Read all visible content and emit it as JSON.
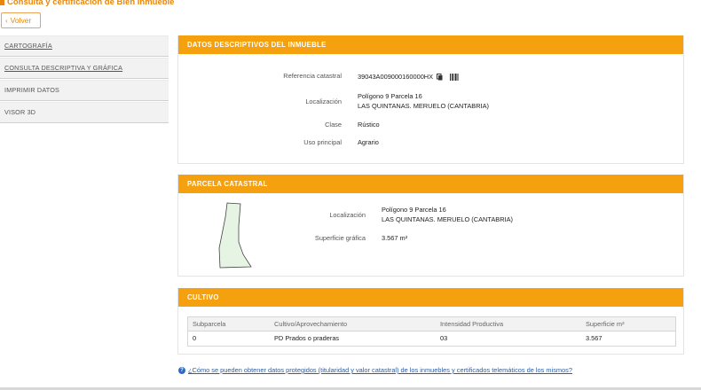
{
  "page": {
    "title": "Consulta y certificación de Bien Inmueble",
    "back_label": "Volver"
  },
  "sidebar": {
    "items": [
      {
        "label": "CARTOGRAFÍA",
        "link": true
      },
      {
        "label": "CONSULTA DESCRIPTIVA Y GRÁFICA",
        "link": true
      },
      {
        "label": "IMPRIMIR DATOS",
        "link": false
      },
      {
        "label": "VISOR 3D",
        "link": false
      }
    ]
  },
  "descriptivos": {
    "title": "DATOS DESCRIPTIVOS DEL INMUEBLE",
    "ref_label": "Referencia catastral",
    "ref_value": "39043A009000160000HX",
    "loc_label": "Localización",
    "loc_line1": "Polígono 9 Parcela 16",
    "loc_line2": "LAS QUINTANAS. MERUELO (CANTABRIA)",
    "clase_label": "Clase",
    "clase_value": "Rústico",
    "uso_label": "Uso principal",
    "uso_value": "Agrario"
  },
  "parcela": {
    "title": "PARCELA CATASTRAL",
    "loc_label": "Localización",
    "loc_line1": "Polígono 9 Parcela 16",
    "loc_line2": "LAS QUINTANAS. MERUELO (CANTABRIA)",
    "sup_label": "Superficie gráfica",
    "sup_value": "3.567 m²"
  },
  "cultivo": {
    "title": "CULTIVO",
    "headers": [
      "Subparcela",
      "Cultivo/Aprovechamiento",
      "Intensidad Productiva",
      "Superficie m²"
    ],
    "rows": [
      [
        "0",
        "PD Prados o praderas",
        "03",
        "3.567"
      ]
    ]
  },
  "footer": {
    "link_text": "¿Cómo se pueden obtener datos protegidos (titularidad y valor catastral) de los inmuebles y certificados telemáticos de los mismos?"
  },
  "colors": {
    "accent": "#f5a00f",
    "title": "#e8870c",
    "link": "#2a5ea8",
    "parcel_fill": "#e6f5e3"
  }
}
